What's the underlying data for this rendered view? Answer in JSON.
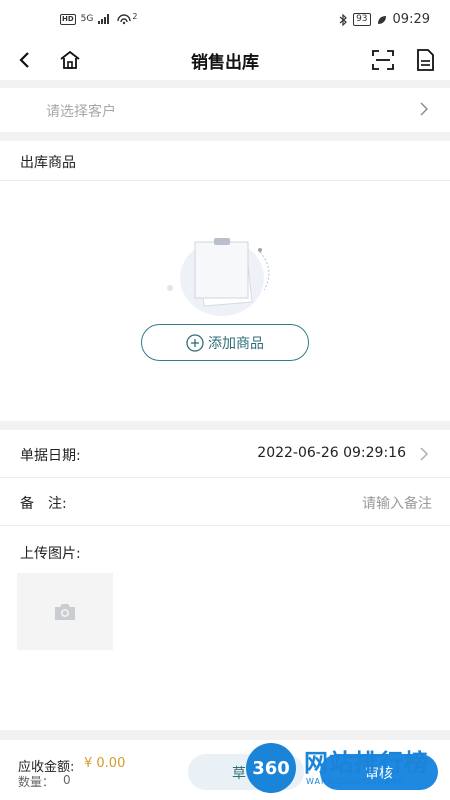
{
  "status_bar": {
    "network_badge": "HD",
    "network_type": "5G",
    "hotspot_count": "2",
    "battery": "93",
    "time": "09:29"
  },
  "header": {
    "title": "销售出库",
    "icons": [
      "back-arrow",
      "home",
      "scan",
      "document"
    ]
  },
  "customer": {
    "placeholder": "请选择客户"
  },
  "goods": {
    "section_title": "出库商品",
    "add_button_label": "添加商品"
  },
  "form": {
    "date_label": "单据日期:",
    "date_value": "2022-06-26 09:29:16",
    "remark_label": "备　注:",
    "remark_placeholder": "请输入备注",
    "upload_label": "上传图片:"
  },
  "footer": {
    "amount_label": "应收金额:",
    "amount_value": "¥ 0.00",
    "quantity_label": "数量：",
    "quantity_value": "0",
    "draft_label": "草",
    "audit_label": "审核"
  },
  "watermark": {
    "logo_text": "360",
    "site_text": "网站排行榜",
    "sub_text": "WANGZHANPAIHANG"
  },
  "colors": {
    "accent": "#1f88e0",
    "amount": "#d79a2b",
    "outline": "#2f7f8a"
  }
}
